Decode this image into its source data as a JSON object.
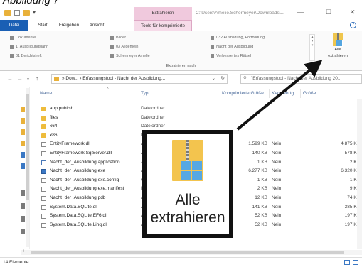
{
  "caption": "Abbildung 7",
  "window": {
    "context_tab_header": "Extrahieren",
    "title_path": "C:\\Users\\Amelie.Schermeyer\\Downloads\\...",
    "qat_dropdown": "▾",
    "minimize": "—",
    "maximize": "☐",
    "close": "✕"
  },
  "tabs": [
    {
      "label": "Datei"
    },
    {
      "label": "Start"
    },
    {
      "label": "Freigeben"
    },
    {
      "label": "Ansicht"
    },
    {
      "label": "Tools für komprimierte Ordner"
    }
  ],
  "ribbon": {
    "locations": [
      "Dokumente",
      "1. Ausbildungsjahr",
      "01 Berichtsheft",
      "Bilder",
      "03 Allgemein",
      "Schermeyer Amelie",
      "032 Ausbildung, Fortbildung",
      "Nacht der Ausbildung",
      "Verbessertes Rätsel"
    ],
    "big_button_line1": "Alle",
    "big_button_line2": "extrahieren",
    "group_label": "Extrahieren nach"
  },
  "address": {
    "path": "» Dow... › Erfassungstool - Nacht der Ausbildung...",
    "search_placeholder": "\"Erfassungstool - Nacht der Ausbildung 20..."
  },
  "columns": {
    "name": "Name",
    "type": "Typ",
    "compressed_size": "Komprimierte Größe",
    "protected": "Kennwortg...",
    "size": "Größe"
  },
  "files": [
    {
      "name": "app.publish",
      "type": "Dateiordner",
      "icon": "folder",
      "csize": "",
      "prot": "",
      "size": ""
    },
    {
      "name": "files",
      "type": "Dateiordner",
      "icon": "folder",
      "csize": "",
      "prot": "",
      "size": ""
    },
    {
      "name": "x64",
      "type": "Dateiordner",
      "icon": "folder",
      "csize": "",
      "prot": "",
      "size": ""
    },
    {
      "name": "x86",
      "type": "D",
      "icon": "folder",
      "csize": "",
      "prot": "",
      "size": ""
    },
    {
      "name": "EntityFramework.dll",
      "type": "A",
      "icon": "file",
      "csize": "1.599 KB",
      "prot": "Nein",
      "size": "4.875 KB"
    },
    {
      "name": "EntityFramework.SqlServer.dll",
      "type": "A",
      "icon": "file",
      "csize": "140 KB",
      "prot": "Nein",
      "size": "578 KB"
    },
    {
      "name": "Nacht_der_Ausbildung.application",
      "type": "A",
      "icon": "app",
      "csize": "1 KB",
      "prot": "Nein",
      "size": "2 KB"
    },
    {
      "name": "Nacht_der_Ausbildung.exe",
      "type": "A",
      "icon": "exe",
      "csize": "6.277 KB",
      "prot": "Nein",
      "size": "6.320 KB"
    },
    {
      "name": "Nacht_der_Ausbildung.exe.config",
      "type": "C",
      "icon": "file",
      "csize": "1 KB",
      "prot": "Nein",
      "size": "1 KB"
    },
    {
      "name": "Nacht_der_Ausbildung.exe.manifest",
      "type": "M",
      "icon": "file",
      "csize": "2 KB",
      "prot": "Nein",
      "size": "9 KB"
    },
    {
      "name": "Nacht_der_Ausbildung.pdb",
      "type": "A",
      "icon": "file",
      "csize": "12 KB",
      "prot": "Nein",
      "size": "74 KB"
    },
    {
      "name": "System.Data.SQLite.dll",
      "type": "A",
      "icon": "file",
      "csize": "141 KB",
      "prot": "Nein",
      "size": "385 KB"
    },
    {
      "name": "System.Data.SQLite.EF6.dll",
      "type": "A",
      "icon": "file",
      "csize": "52 KB",
      "prot": "Nein",
      "size": "197 KB"
    },
    {
      "name": "System.Data.SQLite.Linq.dll",
      "type": "A",
      "icon": "file",
      "csize": "52 KB",
      "prot": "Nein",
      "size": "197 KB"
    }
  ],
  "status": {
    "count": "14 Elemente"
  },
  "zoom": {
    "line1": "Alle",
    "line2": "extrahieren"
  },
  "colors": {
    "accent": "#1a5fb4",
    "context_tab": "#f6dbe9",
    "folder": "#eebc3c",
    "zip_blue": "#56a8e3"
  }
}
